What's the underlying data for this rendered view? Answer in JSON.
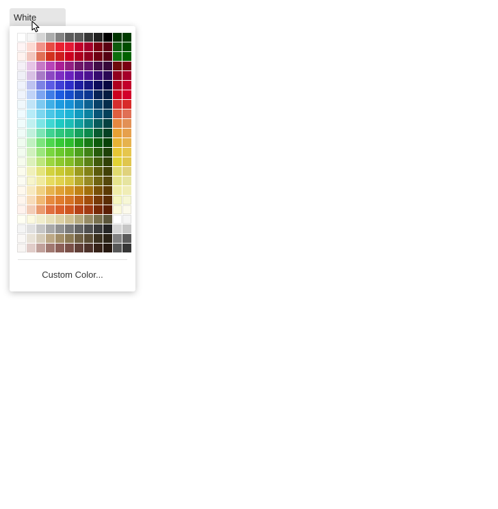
{
  "picker": {
    "selected_label": "White",
    "custom_label": "Custom Color..."
  },
  "palette": {
    "columns": 12,
    "rows": 23,
    "colors": [
      "#ffffff",
      "#f5f5f5",
      "#d5d5d5",
      "#abacac",
      "#828282",
      "#5b5b5b",
      "#575757",
      "#363636",
      "#202020",
      "#000000",
      "#003400",
      "#003c00",
      "#fff5f5",
      "#fcdad3",
      "#f09289",
      "#e64b44",
      "#e92031",
      "#e41835",
      "#c2002a",
      "#a5002a",
      "#7a0012",
      "#5b0012",
      "#0d5b0d",
      "#004d00",
      "#fff3f0",
      "#f2c6bd",
      "#e06f55",
      "#d2311e",
      "#ce1d1e",
      "#cc001e",
      "#ae001e",
      "#91001e",
      "#6f0012",
      "#550012",
      "#0d6f0d",
      "#006100",
      "#f5f0f7",
      "#e6c4e6",
      "#c679c6",
      "#b744b7",
      "#aa1f95",
      "#921f82",
      "#6e1668",
      "#611268",
      "#410c48",
      "#36073a",
      "#6f0c0c",
      "#7a0012",
      "#f0f0f7",
      "#d8c0e4",
      "#a779c6",
      "#8b47c2",
      "#7c2dc2",
      "#6920bd",
      "#5516a1",
      "#4b1291",
      "#360a6f",
      "#2a0755",
      "#91001e",
      "#a5002a",
      "#f0f3fc",
      "#bdc2f0",
      "#7c82e4",
      "#5b5be4",
      "#3f3fd6",
      "#2d2dc9",
      "#1d1da1",
      "#161682",
      "#0c0c5b",
      "#070741",
      "#ae001e",
      "#c2002a",
      "#f0f4fc",
      "#c0d3f7",
      "#7ca4f0",
      "#3f7ce6",
      "#1d5be0",
      "#164dcc",
      "#1242a5",
      "#0c3691",
      "#072355",
      "#041b41",
      "#cc001e",
      "#d2002a",
      "#f0f8fc",
      "#c0e4f7",
      "#7cc9f0",
      "#3fafe6",
      "#1d9be0",
      "#1691d6",
      "#127ab5",
      "#0c6191",
      "#074168",
      "#042d4c",
      "#d62d2d",
      "#d82a2a",
      "#f0fbff",
      "#b6ebf7",
      "#7cd6ef",
      "#4ac6e6",
      "#2dbde0",
      "#1eb4d6",
      "#129bbf",
      "#0c82a1",
      "#075577",
      "#04415b",
      "#e05f3f",
      "#e06f55",
      "#f0fcfc",
      "#c0f0f0",
      "#7ce4e4",
      "#3fd6d2",
      "#1dc9c2",
      "#1bbdb6",
      "#12a1a1",
      "#0c8282",
      "#075b5b",
      "#044141",
      "#e6883f",
      "#e29055",
      "#f0fcf8",
      "#c0f0dc",
      "#7ce4b4",
      "#3fd291",
      "#2dc67c",
      "#24bd73",
      "#16a15f",
      "#0c8a4d",
      "#075b31",
      "#044124",
      "#e6a034",
      "#e6a04d",
      "#f0fcf0",
      "#c0f0c0",
      "#7ce47c",
      "#4dd64d",
      "#36c936",
      "#2dbd2d",
      "#1e9b1e",
      "#167a16",
      "#0c5b0c",
      "#074107",
      "#e6b234",
      "#e6b24d",
      "#f3fcf0",
      "#d0f0bd",
      "#9be67c",
      "#79d63f",
      "#6ac92d",
      "#5ebd24",
      "#4da11e",
      "#3f8216",
      "#275b0c",
      "#1e4107",
      "#e6c634",
      "#e6c64d",
      "#f7fcee",
      "#dcf0ba",
      "#bde67c",
      "#9bd63f",
      "#8cc92d",
      "#82bd24",
      "#6fa11e",
      "#5b8216",
      "#415b0c",
      "#314107",
      "#e0d234",
      "#e0c64d",
      "#fcfcee",
      "#f0f0ba",
      "#e4e47c",
      "#d2d23f",
      "#c9c931",
      "#bdbd2a",
      "#9b9b1e",
      "#828216",
      "#5b5b0c",
      "#414107",
      "#e0db6f",
      "#e0d27c",
      "#fcfcf3",
      "#f7f5cc",
      "#f0ea9e",
      "#e6db5f",
      "#e0d24d",
      "#d6c63f",
      "#b5a82d",
      "#968a24",
      "#6f6412",
      "#55480c",
      "#e6e48c",
      "#e6e4a0",
      "#fff9ee",
      "#f7e9c0",
      "#f0d082",
      "#e6b24d",
      "#e0a034",
      "#d69524",
      "#bf8216",
      "#a16f0c",
      "#775007",
      "#5b3a04",
      "#f0eda8",
      "#f0edb6",
      "#fff6ee",
      "#f7dcba",
      "#f0b874",
      "#e68a3f",
      "#e07c2d",
      "#d67324",
      "#bf5f16",
      "#a14d0c",
      "#773a07",
      "#5b2d04",
      "#f7f7c0",
      "#f7f7d6",
      "#fff3ee",
      "#f2cdb7",
      "#ea9b6f",
      "#e06f3f",
      "#da5f2a",
      "#ce551e",
      "#b54116",
      "#a13a12",
      "#772a07",
      "#5b1f04",
      "#fcfadc",
      "#fcfaec",
      "#fffff3",
      "#fcfae0",
      "#f0edcc",
      "#e6dfb8",
      "#dcd0a4",
      "#cfc092",
      "#b5a87c",
      "#968a64",
      "#78704e",
      "#5b553a",
      "#ffffff",
      "#f5f5f5",
      "#f5f5f5",
      "#e0e0e0",
      "#c6c6c6",
      "#a8a8a8",
      "#919191",
      "#7a7a7a",
      "#646464",
      "#4f4f4f",
      "#3a3a3a",
      "#252525",
      "#d5d5d5",
      "#c6c6c6",
      "#faf8f6",
      "#e8e2d7",
      "#d5cbb8",
      "#bca886",
      "#a38e68",
      "#8c7a55",
      "#706044",
      "#5a4c34",
      "#3a301f",
      "#2a2216",
      "#828282",
      "#5b5b5b",
      "#f8f5f3",
      "#e0ccc8",
      "#c0a09a",
      "#a07870",
      "#8c6058",
      "#7a5048",
      "#614038",
      "#4d322a",
      "#362218",
      "#261810",
      "#575757",
      "#363636"
    ]
  }
}
